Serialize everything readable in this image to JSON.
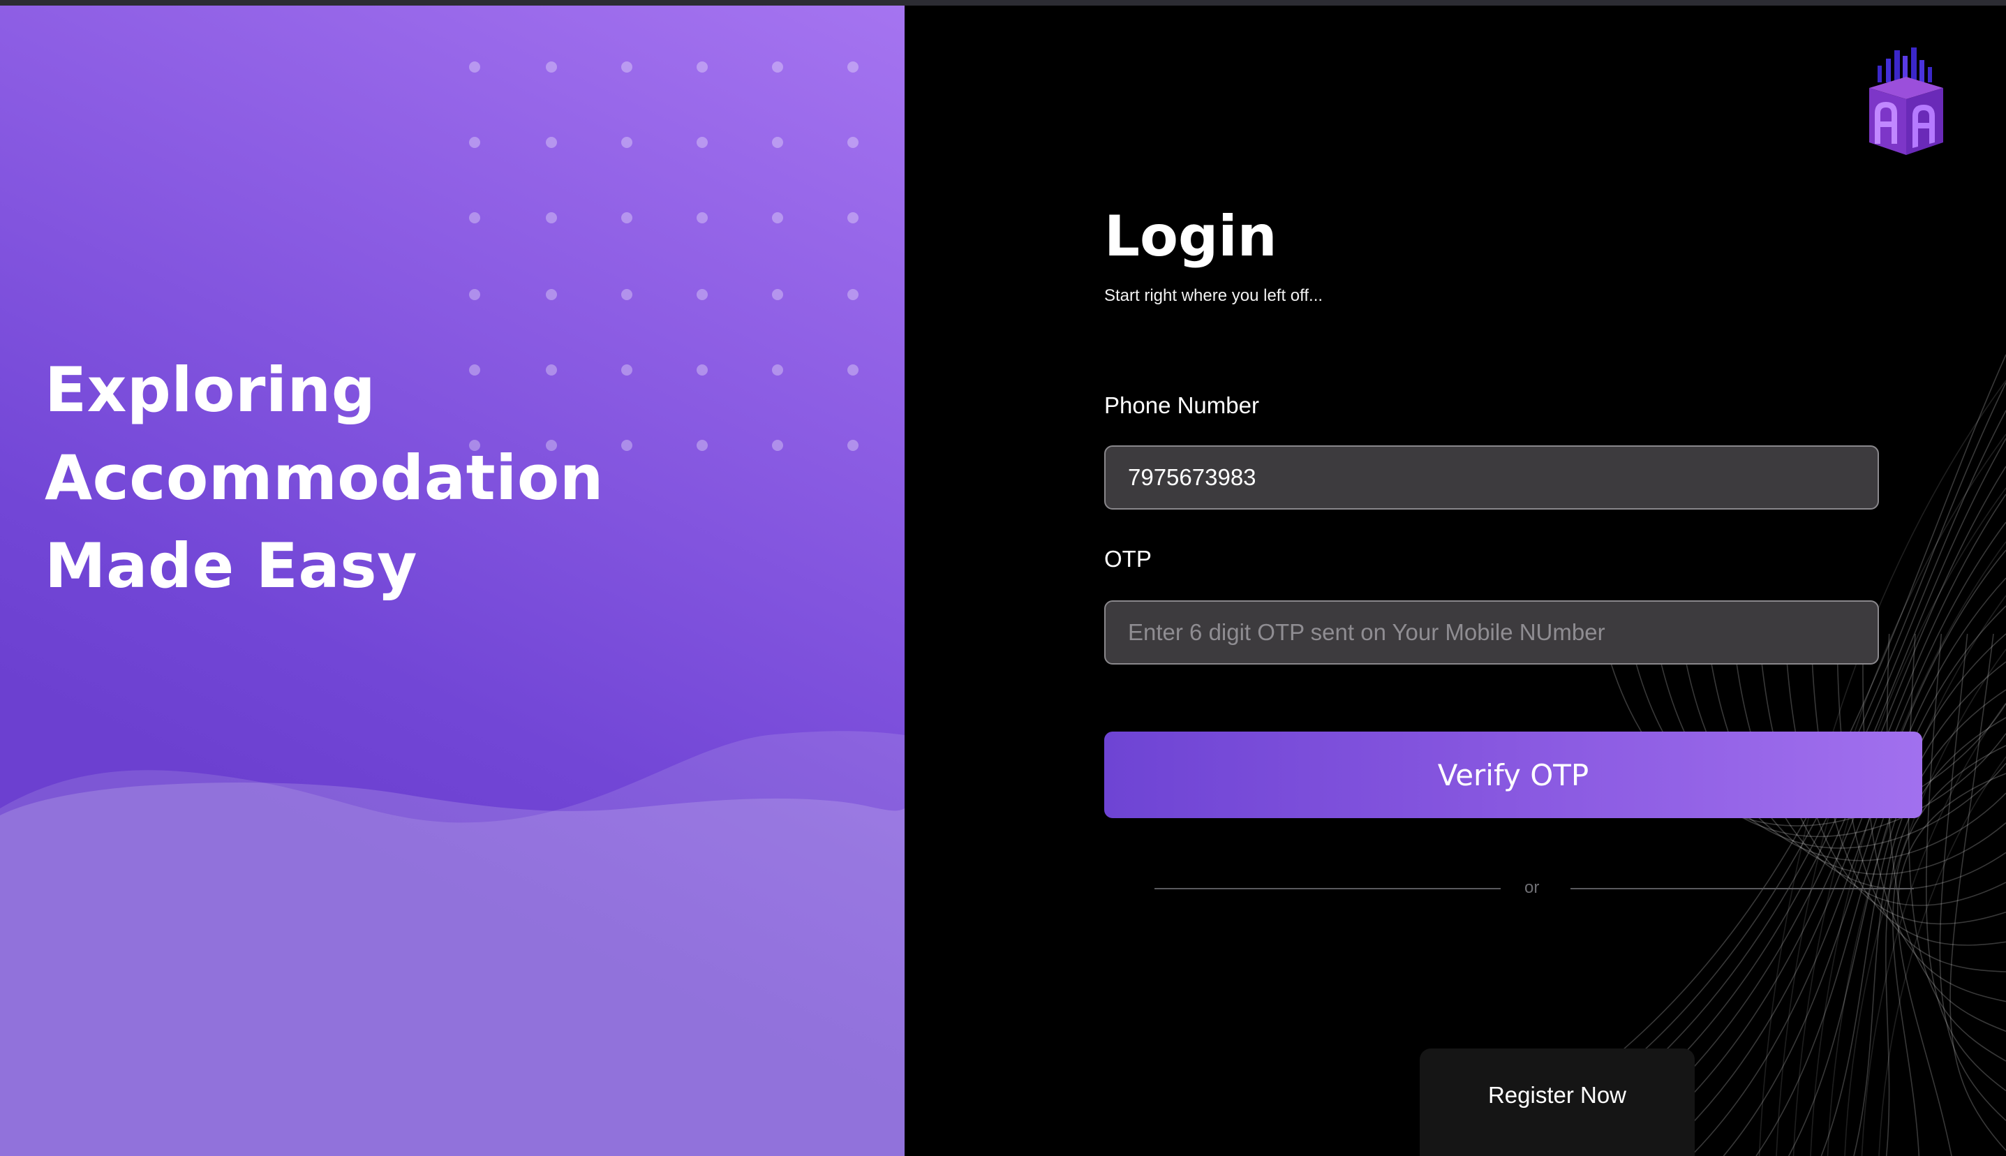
{
  "hero": {
    "headline_lines": [
      "Exploring",
      "Accommodation",
      "Made Easy"
    ],
    "gradient_colors": [
      "#a574f0",
      "#6c40d0"
    ]
  },
  "login": {
    "title": "Login",
    "subtitle": "Start right where you left off...",
    "phone": {
      "label": "Phone Number",
      "value": "7975673983"
    },
    "otp": {
      "label": "OTP",
      "value": "",
      "placeholder": "Enter 6 digit OTP sent on Your Mobile NUmber"
    },
    "verify_button_label": "Verify OTP",
    "divider_text": "or",
    "register_button_label": "Register Now",
    "logo_icon": "brand-logo-icon",
    "accent_color": "#8656df"
  }
}
